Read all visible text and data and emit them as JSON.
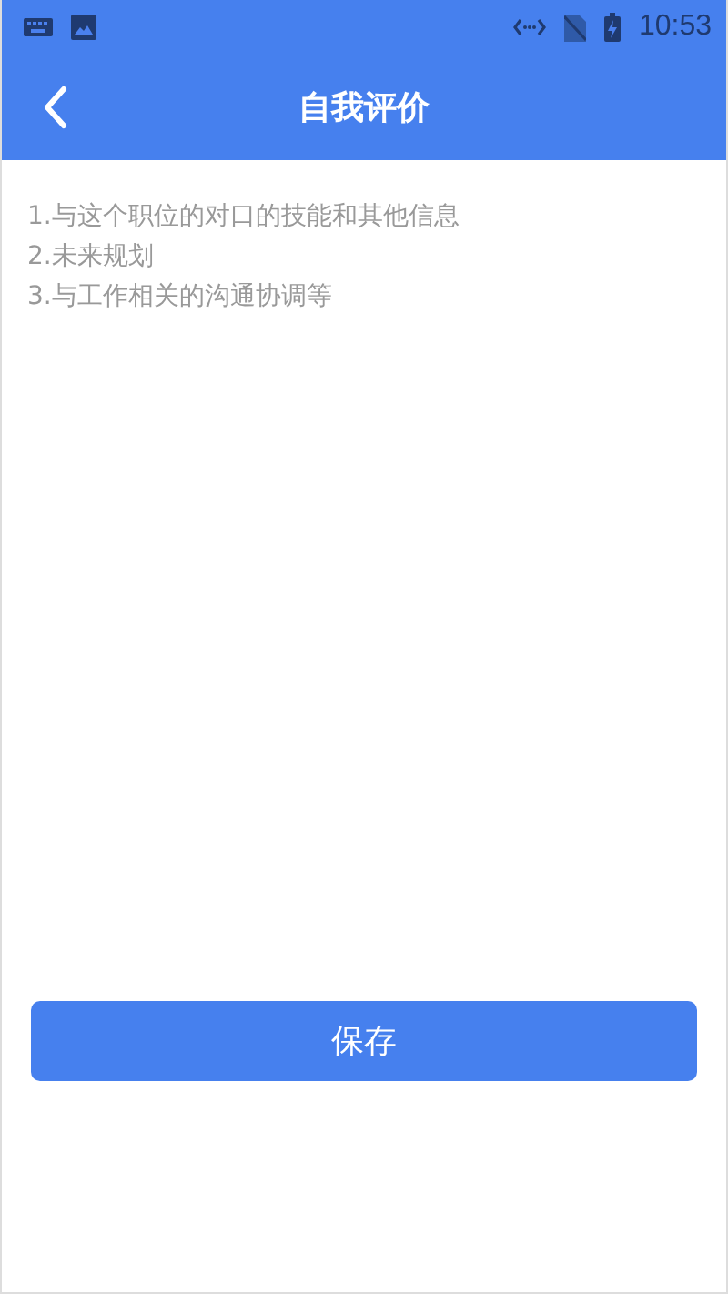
{
  "status_bar": {
    "time": "10:53"
  },
  "header": {
    "title": "自我评价"
  },
  "editor": {
    "placeholder": "1.与这个职位的对口的技能和其他信息\n2.未来规划\n3.与工作相关的沟通协调等"
  },
  "buttons": [
    {
      "label": "保存"
    }
  ]
}
